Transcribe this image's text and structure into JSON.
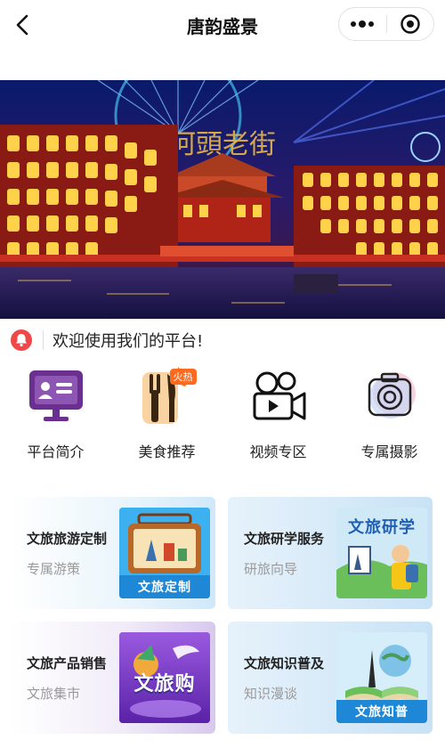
{
  "navbar": {
    "title": "唐韵盛景",
    "back_icon": "chevron-left-icon",
    "more_icon": "more-dots-icon",
    "close_icon": "target-circle-icon"
  },
  "banner": {
    "sign_text": "河頭老街"
  },
  "notice": {
    "icon": "bell-icon",
    "text": "欢迎使用我们的平台!"
  },
  "quick_links": [
    {
      "label": "平台简介",
      "icon": "monitor-profile-icon"
    },
    {
      "label": "美食推荐",
      "icon": "fork-knife-icon",
      "badge": "火热"
    },
    {
      "label": "视频专区",
      "icon": "video-camera-icon"
    },
    {
      "label": "专属摄影",
      "icon": "camera-lens-icon"
    }
  ],
  "cards": [
    {
      "title": "文旅旅游定制",
      "subtitle": "专属游策",
      "thumb_caption": "文旅定制"
    },
    {
      "title": "文旅研学服务",
      "subtitle": "研旅向导",
      "thumb_caption": "文旅研学"
    },
    {
      "title": "文旅产品销售",
      "subtitle": "文旅集市",
      "thumb_caption": "文旅购"
    },
    {
      "title": "文旅知识普及",
      "subtitle": "知识漫谈",
      "thumb_caption": "文旅知普"
    }
  ],
  "colors": {
    "notice_bell": "#f04848",
    "hot_badge": "#ff6a1f",
    "card_blue": "#dff0fb",
    "card_purple": "#ece7f6",
    "icon_purple": "#6a2f8f"
  }
}
